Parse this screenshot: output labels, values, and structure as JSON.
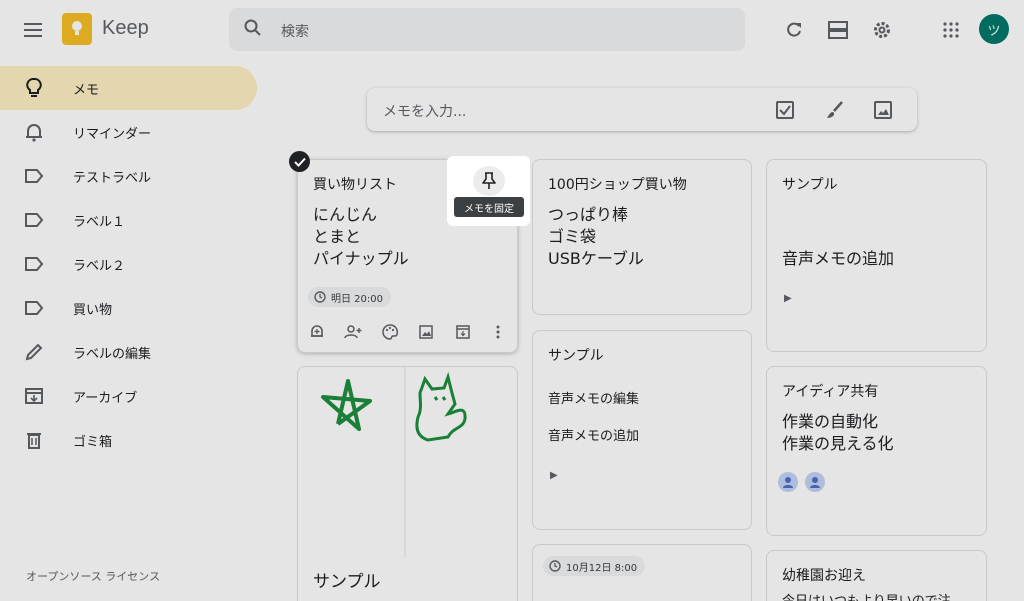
{
  "header": {
    "app_name": "Keep",
    "search_placeholder": "検索",
    "avatar_initial": "ツ"
  },
  "sidebar": {
    "items": [
      {
        "label": "メモ",
        "icon": "lightbulb-icon",
        "active": true
      },
      {
        "label": "リマインダー",
        "icon": "bell-icon"
      },
      {
        "label": "テストラベル",
        "icon": "label-icon"
      },
      {
        "label": "ラベル１",
        "icon": "label-icon"
      },
      {
        "label": "ラベル２",
        "icon": "label-icon"
      },
      {
        "label": "買い物",
        "icon": "label-icon"
      },
      {
        "label": "ラベルの編集",
        "icon": "pencil-icon"
      },
      {
        "label": "アーカイブ",
        "icon": "archive-icon"
      },
      {
        "label": "ゴミ箱",
        "icon": "trash-icon"
      }
    ],
    "license": "オープンソース ライセンス"
  },
  "take_note": {
    "placeholder": "メモを入力..."
  },
  "notes": {
    "shopping": {
      "title": "買い物リスト",
      "lines": [
        "にんじん",
        "とまと",
        "パイナップル"
      ],
      "reminder": "明日 20:00"
    },
    "shop100": {
      "title": "100円ショップ買い物",
      "lines": [
        "つっぱり棒",
        "ゴミ袋",
        "USBケーブル"
      ]
    },
    "sample_right": {
      "title": "サンプル",
      "line": "音声メモの追加"
    },
    "sample_mid": {
      "title": "サンプル",
      "lines": [
        "音声メモの編集",
        "音声メモの追加"
      ]
    },
    "drawing": {
      "title": "サンプル"
    },
    "idea": {
      "title": "アイディア共有",
      "lines": [
        "作業の自動化",
        "作業の見える化"
      ]
    },
    "reminder_chip": {
      "text": "10月12日 8:00"
    },
    "kindergarten": {
      "title": "幼稚園お迎え",
      "line": "今日はいつもより早いので注"
    }
  },
  "tooltip": "メモを固定",
  "colors": {
    "active_nav": "#feefc3",
    "logo": "#f5bf26",
    "avatar": "#00796b",
    "drawing_ink": "#1e8e3e"
  }
}
